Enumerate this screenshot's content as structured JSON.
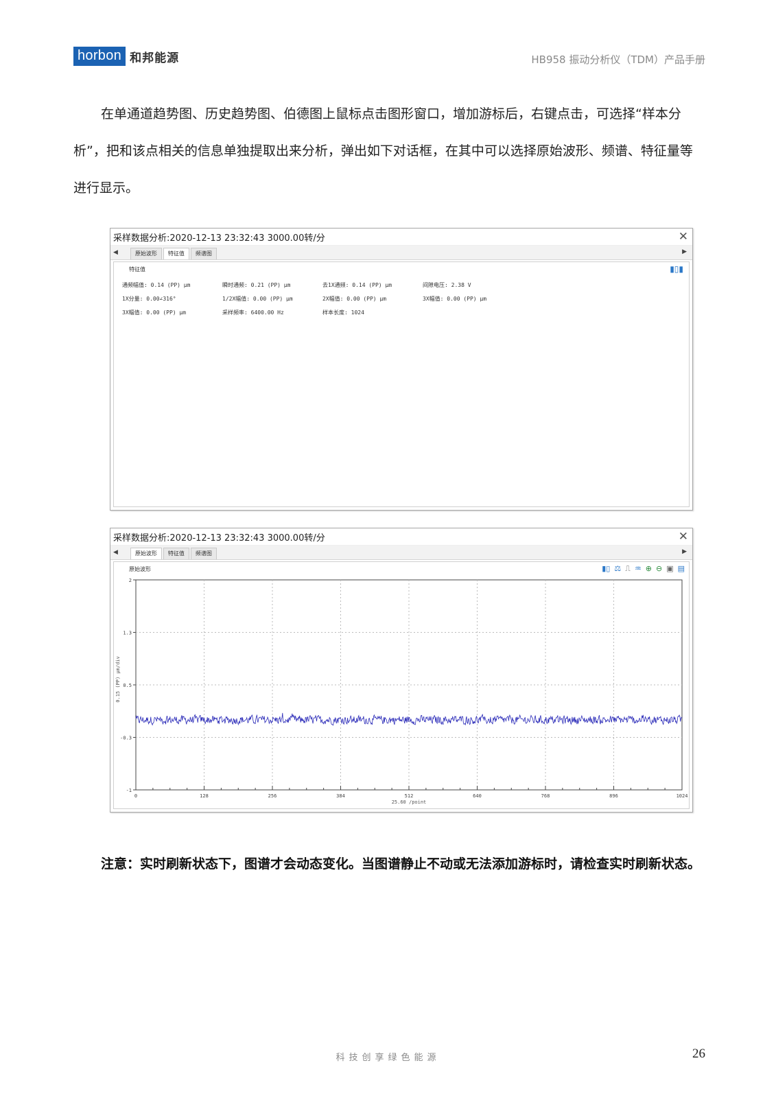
{
  "header": {
    "logo_text": "horbon",
    "logo_cn": "和邦能源",
    "doc_title": "HB958 振动分析仪（TDM）产品手册"
  },
  "intro": "在单通道趋势图、历史趋势图、伯德图上鼠标点击图形窗口，增加游标后，右键点击，可选择“样本分析”，把和该点相关的信息单独提取出来分析，弹出如下对话框，在其中可以选择原始波形、频谱、特征量等进行显示。",
  "dialog1": {
    "title": "采样数据分析:2020-12-13 23:32:43   3000.00转/分",
    "tabs": [
      "原始波形",
      "特征值",
      "频谱图"
    ],
    "active_tab": 1,
    "panel_label": "特征值",
    "features": [
      "通频幅值: 0.14 (PP) μm",
      "瞬时通频: 0.21 (PP) μm",
      "去1X通频: 0.14 (PP) μm",
      "间隙电压: 2.38 V",
      "1X分量: 0.00∠316°",
      "1/2X幅值: 0.00 (PP) μm",
      "2X幅值: 0.00 (PP) μm",
      "3X幅值: 0.00 (PP) μm",
      "3X幅值: 0.00 (PP) μm",
      "采样频率: 6400.00 Hz",
      "样本长度: 1024",
      ""
    ]
  },
  "dialog2": {
    "title": "采样数据分析:2020-12-13 23:32:43   3000.00转/分",
    "tabs": [
      "原始波形",
      "特征值",
      "频谱图"
    ],
    "active_tab": 0,
    "panel_label": "原始波形",
    "toolbar_icons": [
      "bar-chart-icon",
      "scale-icon",
      "cursor-icon",
      "waterfall-icon",
      "zoom-in-icon",
      "zoom-out-icon",
      "camera-icon",
      "save-icon"
    ]
  },
  "chart_data": {
    "type": "line",
    "series": [
      {
        "name": "",
        "color": "#2a2ab8"
      }
    ],
    "x_ticks": [
      "0",
      "128",
      "256",
      "384",
      "512",
      "640",
      "768",
      "896",
      "1024"
    ],
    "y_ticks": [
      "2",
      "1.3",
      "0.5",
      "-0.3",
      "-1"
    ],
    "xlim": [
      0,
      1024
    ],
    "ylim": [
      -1,
      2
    ],
    "xlabel": "25.60 /point",
    "ylabel": "0.15 (PP) μm/div",
    "baseline": 0.0,
    "noise_amplitude": 0.08,
    "points": 1024,
    "grid": true
  },
  "note": "注意：实时刷新状态下，图谱才会动态变化。当图谱静止不动或无法添加游标时，请检查实时刷新状态。",
  "footer": {
    "slogan": "科技创享绿色能源",
    "page_number": "26"
  }
}
